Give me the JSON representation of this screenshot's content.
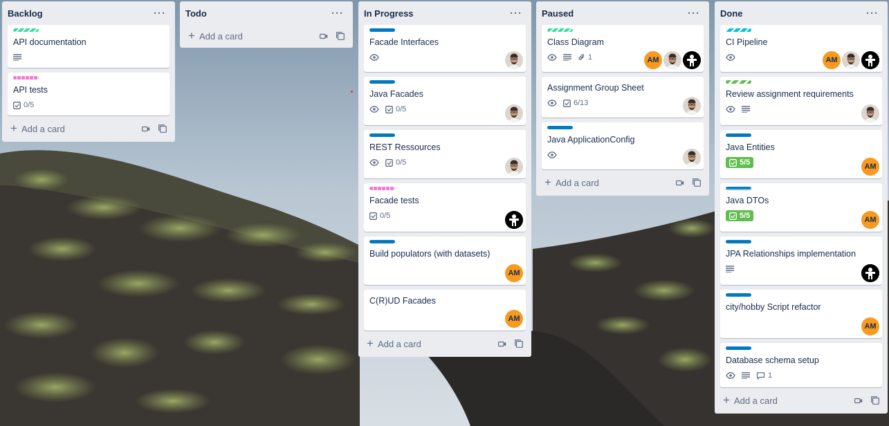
{
  "lists": [
    {
      "title": "Backlog",
      "add_card_label": "Add a card",
      "cards": [
        {
          "title": "API documentation",
          "labels": [
            "teal-striped"
          ],
          "badges": [
            "description"
          ]
        },
        {
          "title": "API tests",
          "labels": [
            "pink"
          ],
          "checklist": "0/5"
        }
      ]
    },
    {
      "title": "Todo",
      "add_card_label": "Add a card",
      "cards": []
    },
    {
      "title": "In Progress",
      "add_card_label": "Add a card",
      "cards": [
        {
          "title": "Facade Interfaces",
          "labels": [
            "blue"
          ],
          "badges": [
            "watch"
          ],
          "members": [
            "photo"
          ]
        },
        {
          "title": "Java Facades",
          "labels": [
            "blue"
          ],
          "badges": [
            "watch"
          ],
          "checklist": "0/5",
          "members": [
            "photo"
          ]
        },
        {
          "title": "REST Ressources",
          "labels": [
            "blue"
          ],
          "badges": [
            "watch"
          ],
          "checklist": "0/5",
          "members": [
            "photo"
          ]
        },
        {
          "title": "Facade tests",
          "labels": [
            "pink"
          ],
          "checklist": "0/5",
          "members": [
            "mascot"
          ]
        },
        {
          "title": "Build populators (with datasets)",
          "labels": [
            "blue"
          ],
          "members": [
            "AM"
          ]
        },
        {
          "title": "C(R)UD Facades",
          "labels": [],
          "members": [
            "AM"
          ]
        }
      ]
    },
    {
      "title": "Paused",
      "add_card_label": "Add a card",
      "cards": [
        {
          "title": "Class Diagram",
          "labels": [
            "teal-striped"
          ],
          "badges": [
            "watch",
            "description"
          ],
          "attachments": "1",
          "members": [
            "AM",
            "photo",
            "mascot"
          ]
        },
        {
          "title": "Assignment Group Sheet",
          "labels": [],
          "badges": [
            "watch"
          ],
          "checklist": "6/13",
          "members": [
            "photo"
          ]
        },
        {
          "title": "Java ApplicationConfig",
          "labels": [
            "blue"
          ],
          "badges": [
            "watch"
          ],
          "members": [
            "photo"
          ]
        }
      ]
    },
    {
      "title": "Done",
      "add_card_label": "Add a card",
      "cards": [
        {
          "title": "CI Pipeline",
          "labels": [
            "cyan"
          ],
          "badges": [
            "watch"
          ],
          "members": [
            "AM",
            "photo",
            "mascot"
          ]
        },
        {
          "title": "Review assignment requirements",
          "labels": [
            "green"
          ],
          "badges": [
            "watch",
            "description"
          ],
          "members": [
            "photo"
          ]
        },
        {
          "title": "Java Entities",
          "labels": [
            "blue"
          ],
          "checklist_complete": "5/5",
          "members": [
            "AM"
          ]
        },
        {
          "title": "Java DTOs",
          "labels": [
            "blue-outline"
          ],
          "checklist_complete": "5/5",
          "members": [
            "AM"
          ]
        },
        {
          "title": "JPA Relationships implementation",
          "labels": [
            "blue"
          ],
          "badges": [
            "description"
          ],
          "members": [
            "mascot"
          ]
        },
        {
          "title": "city/hobby Script refactor",
          "labels": [
            "blue"
          ],
          "members": [
            "AM"
          ]
        },
        {
          "title": "Database schema setup",
          "labels": [
            "blue"
          ],
          "badges": [
            "watch",
            "description"
          ],
          "comments": "1"
        }
      ]
    }
  ],
  "member_initials": "AM",
  "list_menu_icon": "ellipsis-icon",
  "colors": {
    "list_bg": "#ebecf0",
    "label_blue": "#0079bf",
    "label_teal": "#3fd9a5",
    "label_pink": "#ef7bd3",
    "label_cyan": "#00c2e0",
    "label_green": "#61bd4f",
    "avatar_am": "#f79a1f",
    "checklist_complete": "#61bd4f"
  }
}
